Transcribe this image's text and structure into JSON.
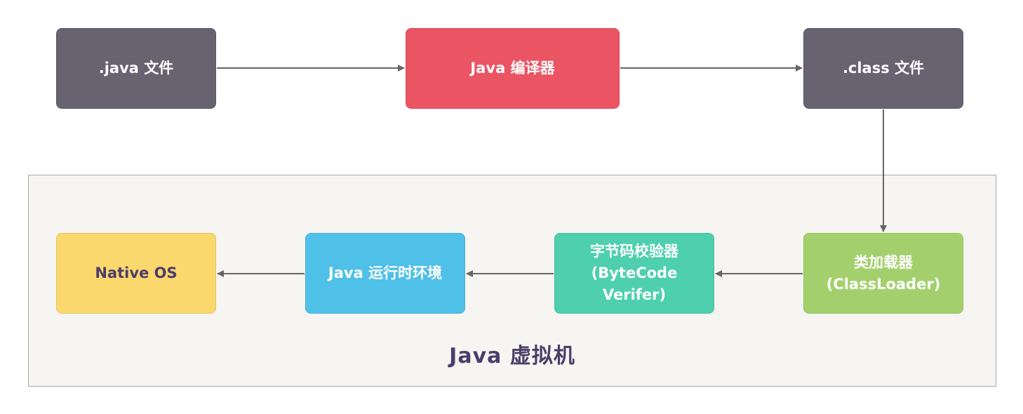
{
  "nodes": {
    "java_file": {
      "line1": ".java 文件"
    },
    "compiler": {
      "line1": "Java 编译器"
    },
    "class_file": {
      "line1": ".class 文件"
    },
    "class_loader": {
      "line1": "类加载器",
      "line2": "(ClassLoader)"
    },
    "verifier": {
      "line1": "字节码校验器",
      "line2": "(ByteCode",
      "line3": "Verifer)"
    },
    "runtime": {
      "line1": "Java 运行时环境"
    },
    "native_os": {
      "line1": "Native OS"
    }
  },
  "region": {
    "label": "Java 虚拟机"
  },
  "colors": {
    "dark_node": "#676370",
    "compiler": "#ea5463",
    "class_loader": "#a3d06c",
    "verifier": "#4ecfad",
    "runtime": "#4fc0e8",
    "native_os": "#fbd86d",
    "region_background": "#f6f5f2",
    "region_label": "#4b3e6a",
    "arrow": "#666666"
  },
  "edges": [
    {
      "from": "java_file",
      "to": "compiler"
    },
    {
      "from": "compiler",
      "to": "class_file"
    },
    {
      "from": "class_file",
      "to": "class_loader"
    },
    {
      "from": "class_loader",
      "to": "verifier"
    },
    {
      "from": "verifier",
      "to": "runtime"
    },
    {
      "from": "runtime",
      "to": "native_os"
    }
  ]
}
